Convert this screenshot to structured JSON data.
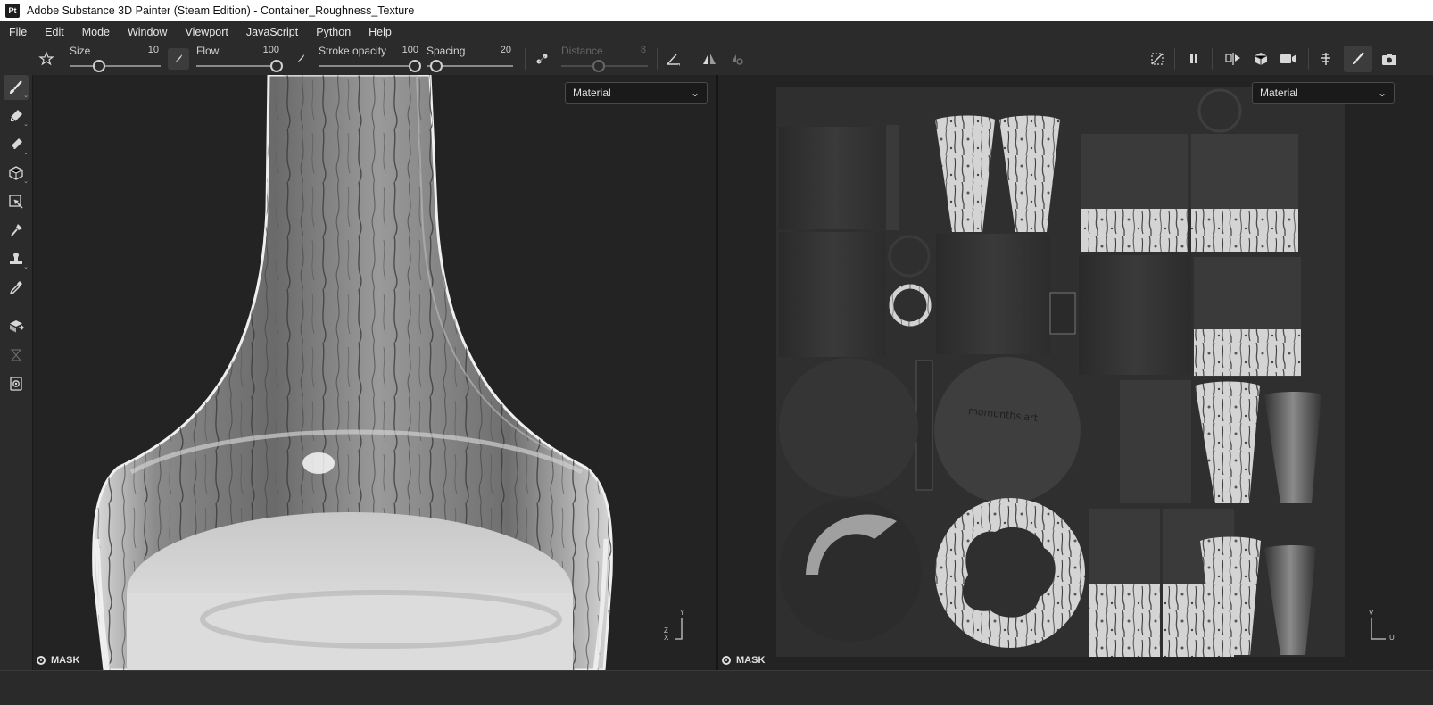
{
  "window": {
    "title": "Adobe Substance 3D Painter (Steam Edition) - Container_Roughness_Texture",
    "logo": "Pt"
  },
  "menu": [
    "File",
    "Edit",
    "Mode",
    "Window",
    "Viewport",
    "JavaScript",
    "Python",
    "Help"
  ],
  "toolbar": {
    "size": {
      "label": "Size",
      "value": "10"
    },
    "flow": {
      "label": "Flow",
      "value": "100"
    },
    "stroke_opacity": {
      "label": "Stroke opacity",
      "value": "100"
    },
    "spacing": {
      "label": "Spacing",
      "value": "20"
    },
    "distance": {
      "label": "Distance",
      "value": "8"
    }
  },
  "left_tools": [
    "paint-brush",
    "eraser",
    "projection",
    "geometry-fill",
    "polygon-fill",
    "smudge",
    "clone",
    "color-picker",
    "bake",
    "history",
    "screenshot"
  ],
  "viewport_3d": {
    "dropdown": "Material",
    "mask_label": "MASK",
    "axis_y": "Y",
    "axis_z": "Z",
    "axis_x": "X"
  },
  "viewport_2d": {
    "dropdown": "Material",
    "mask_label": "MASK",
    "axis_v": "V",
    "axis_u": "U",
    "watermark": "momunths.art"
  },
  "colors": {
    "chrome": "#2b2b2b",
    "viewport_bg": "#232323",
    "uv_bg": "#2e2e2e"
  }
}
